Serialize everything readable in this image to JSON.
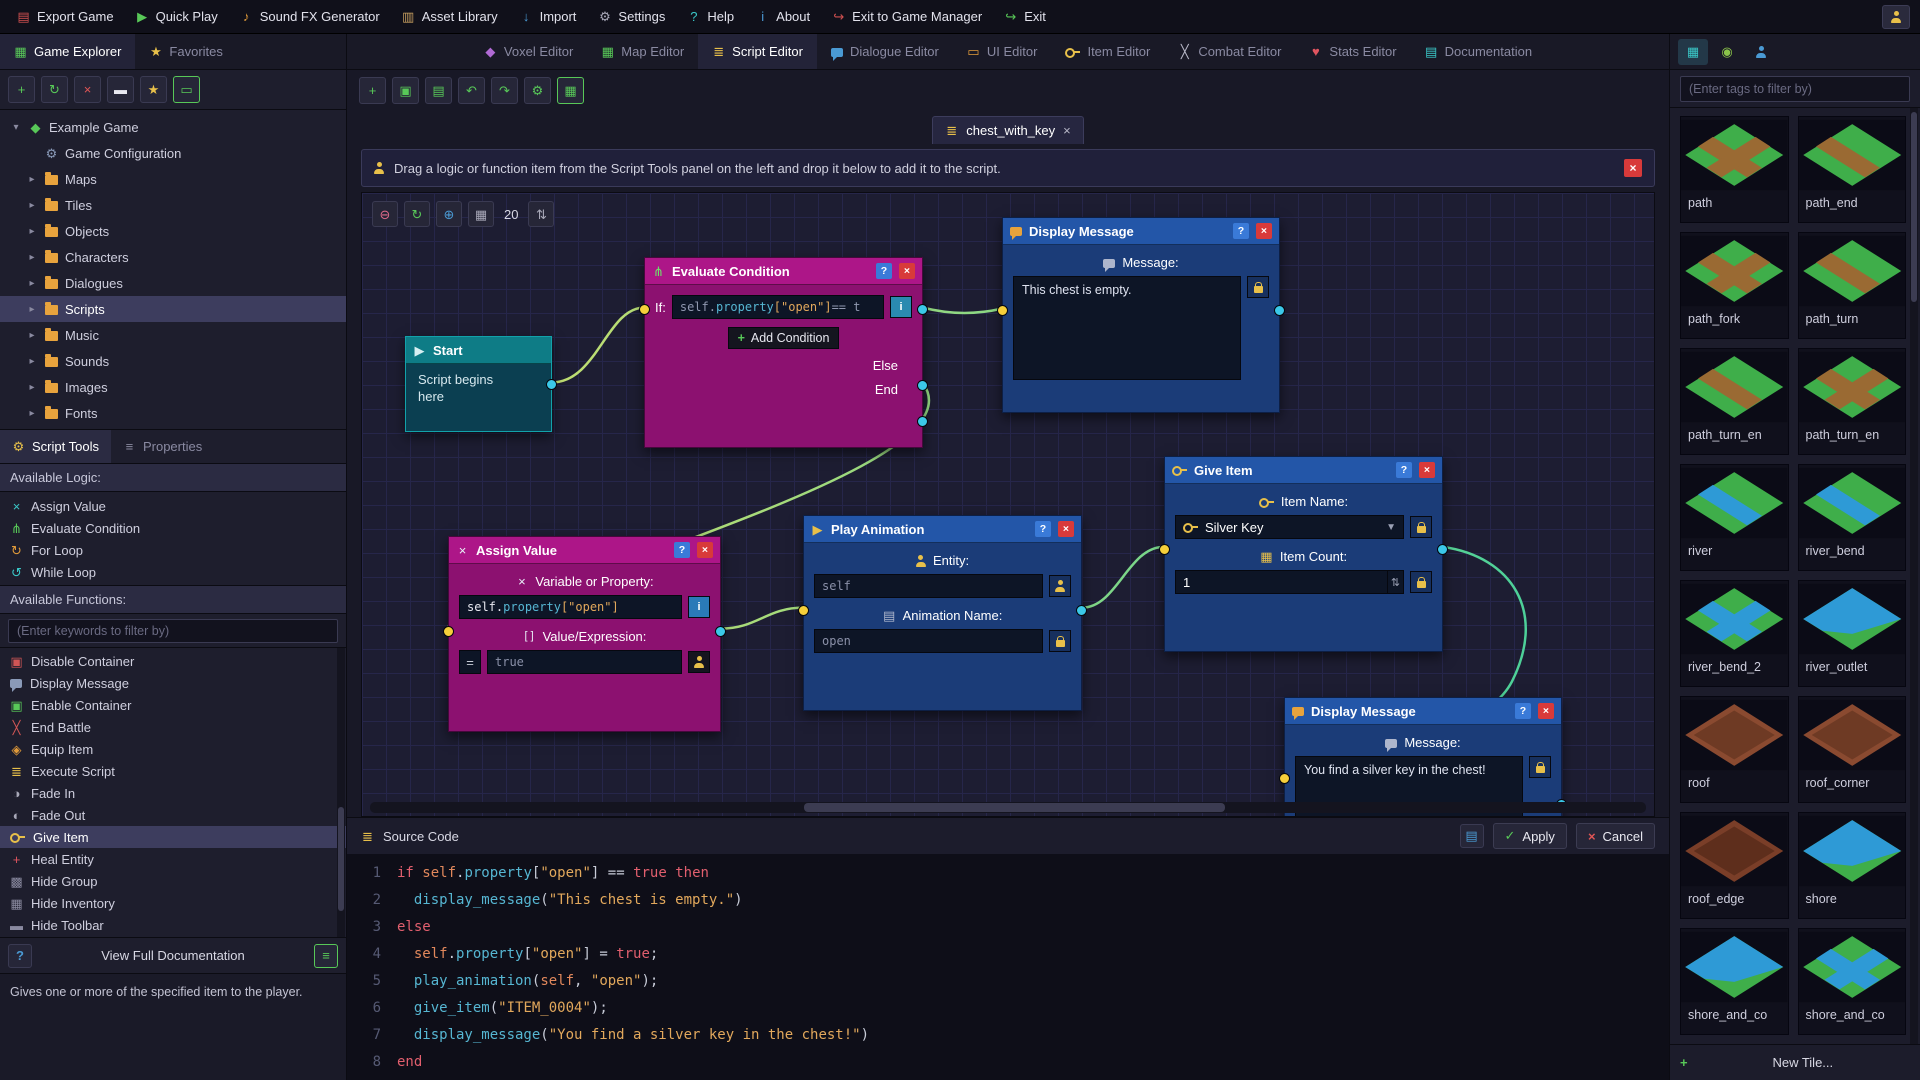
{
  "menubar": {
    "items": [
      {
        "label": "Export Game",
        "icon": "export"
      },
      {
        "label": "Quick Play",
        "icon": "play"
      },
      {
        "label": "Sound FX Generator",
        "icon": "sound"
      },
      {
        "label": "Asset Library",
        "icon": "library"
      },
      {
        "label": "Import",
        "icon": "import"
      },
      {
        "label": "Settings",
        "icon": "settings"
      },
      {
        "label": "Help",
        "icon": "help"
      },
      {
        "label": "About",
        "icon": "about"
      },
      {
        "label": "Exit to Game Manager",
        "icon": "exit-manager"
      },
      {
        "label": "Exit",
        "icon": "exit"
      }
    ]
  },
  "tab_row": {
    "left_tabs": [
      {
        "label": "Game Explorer",
        "icon": "grid",
        "active": true
      },
      {
        "label": "Favorites",
        "icon": "star",
        "active": false
      }
    ],
    "editor_tabs": [
      {
        "label": "Voxel Editor",
        "icon": "voxel",
        "active": false
      },
      {
        "label": "Map Editor",
        "icon": "map",
        "active": false
      },
      {
        "label": "Script Editor",
        "icon": "script",
        "active": true
      },
      {
        "label": "Dialogue Editor",
        "icon": "dialogue",
        "active": false
      },
      {
        "label": "UI Editor",
        "icon": "ui",
        "active": false
      },
      {
        "label": "Item Editor",
        "icon": "item",
        "active": false
      },
      {
        "label": "Combat Editor",
        "icon": "combat",
        "active": false
      },
      {
        "label": "Stats Editor",
        "icon": "stats",
        "active": false
      },
      {
        "label": "Documentation",
        "icon": "docs",
        "active": false
      }
    ],
    "right_tabs": [
      {
        "icon": "tiles",
        "active": true
      },
      {
        "icon": "bulb",
        "active": false
      },
      {
        "icon": "userblue",
        "active": false
      }
    ]
  },
  "explorer": {
    "toolbar": [
      {
        "icon": "add"
      },
      {
        "icon": "refresh"
      },
      {
        "icon": "delete"
      },
      {
        "icon": "collapse"
      },
      {
        "icon": "favorite"
      },
      {
        "icon": "panel-toggle",
        "framed": true
      }
    ],
    "tree": [
      {
        "label": "Example Game",
        "icon": "game",
        "level": 0,
        "expanded": true,
        "selected": false,
        "leaf": false
      },
      {
        "label": "Game Configuration",
        "icon": "config",
        "level": 1,
        "expanded": false,
        "selected": false,
        "leaf": true
      },
      {
        "label": "Maps",
        "icon": "folder",
        "level": 1,
        "expanded": false,
        "selected": false,
        "leaf": false
      },
      {
        "label": "Tiles",
        "icon": "folder",
        "level": 1,
        "expanded": false,
        "selected": false,
        "leaf": false
      },
      {
        "label": "Objects",
        "icon": "folder",
        "level": 1,
        "expanded": false,
        "selected": false,
        "leaf": false
      },
      {
        "label": "Characters",
        "icon": "folder",
        "level": 1,
        "expanded": false,
        "selected": false,
        "leaf": false
      },
      {
        "label": "Dialogues",
        "icon": "folder",
        "level": 1,
        "expanded": false,
        "selected": false,
        "leaf": false
      },
      {
        "label": "Scripts",
        "icon": "folder",
        "level": 1,
        "expanded": false,
        "selected": true,
        "leaf": false
      },
      {
        "label": "Music",
        "icon": "folder",
        "level": 1,
        "expanded": false,
        "selected": false,
        "leaf": false
      },
      {
        "label": "Sounds",
        "icon": "folder",
        "level": 1,
        "expanded": false,
        "selected": false,
        "leaf": false
      },
      {
        "label": "Images",
        "icon": "folder",
        "level": 1,
        "expanded": false,
        "selected": false,
        "leaf": false
      },
      {
        "label": "Fonts",
        "icon": "folder",
        "level": 1,
        "expanded": false,
        "selected": false,
        "leaf": false
      }
    ]
  },
  "script_tools": {
    "tabs": [
      {
        "label": "Script Tools",
        "icon": "tools",
        "active": true
      },
      {
        "label": "Properties",
        "icon": "props",
        "active": false
      }
    ],
    "logic_header": "Available Logic:",
    "logic": [
      {
        "label": "Assign Value",
        "icon": "assign"
      },
      {
        "label": "Evaluate Condition",
        "icon": "evaluate"
      },
      {
        "label": "For Loop",
        "icon": "for"
      },
      {
        "label": "While Loop",
        "icon": "while"
      }
    ],
    "functions_header": "Available Functions:",
    "filter_placeholder": "(Enter keywords to filter by)",
    "functions": [
      {
        "label": "Disable Container",
        "icon": "disable-container",
        "selected": false
      },
      {
        "label": "Display Message",
        "icon": "display-message",
        "selected": false
      },
      {
        "label": "Enable Container",
        "icon": "enable-container",
        "selected": false
      },
      {
        "label": "End Battle",
        "icon": "end-battle",
        "selected": false
      },
      {
        "label": "Equip Item",
        "icon": "equip-item",
        "selected": false
      },
      {
        "label": "Execute Script",
        "icon": "execute-script",
        "selected": false
      },
      {
        "label": "Fade In",
        "icon": "fade-in",
        "selected": false
      },
      {
        "label": "Fade Out",
        "icon": "fade-out",
        "selected": false
      },
      {
        "label": "Give Item",
        "icon": "key",
        "selected": true
      },
      {
        "label": "Heal Entity",
        "icon": "heal",
        "selected": false
      },
      {
        "label": "Hide Group",
        "icon": "hide-group",
        "selected": false
      },
      {
        "label": "Hide Inventory",
        "icon": "hide-inventory",
        "selected": false
      },
      {
        "label": "Hide Toolbar",
        "icon": "hide-toolbar",
        "selected": false
      }
    ],
    "doc_button": "View Full Documentation",
    "description": "Gives one or more of the specified item to the player."
  },
  "editor": {
    "toolbar": [
      {
        "icon": "new"
      },
      {
        "icon": "save"
      },
      {
        "icon": "copy"
      },
      {
        "icon": "undo"
      },
      {
        "icon": "redo"
      },
      {
        "icon": "settings2"
      },
      {
        "icon": "grid-toggle",
        "framed": true
      }
    ],
    "script_tab": {
      "label": "chest_with_key"
    },
    "hint": "Drag a logic or function item from the Script Tools panel on the left and drop it below to add it to the script.",
    "canvas_toolbar": {
      "grid_size": "20"
    }
  },
  "nodes": {
    "start": {
      "title": "Start",
      "body_line1": "Script begins",
      "body_line2": "here"
    },
    "evaluate": {
      "title": "Evaluate Condition",
      "if_label": "If:",
      "condition_segments": [
        {
          "t": "self",
          "c": "dim"
        },
        {
          "t": ".",
          "c": "dim"
        },
        {
          "t": "property",
          "c": "p"
        },
        {
          "t": "[\"open\"]",
          "c": "s"
        },
        {
          "t": " == t",
          "c": "dim"
        }
      ],
      "add_condition_label": "Add Condition",
      "else_label": "Else",
      "end_label": "End"
    },
    "display1": {
      "title": "Display Message",
      "message_label": "Message:",
      "message": "This chest is empty."
    },
    "assign": {
      "title": "Assign Value",
      "var_label": "Variable or Property:",
      "var_segments": [
        {
          "t": "self",
          "c": "w"
        },
        {
          "t": ".",
          "c": "w"
        },
        {
          "t": "property",
          "c": "p"
        },
        {
          "t": "[\"open\"]",
          "c": "s"
        }
      ],
      "value_label": "Value/Expression:",
      "value_bracket_icon": "[ ]",
      "equals": "=",
      "value": "true"
    },
    "play": {
      "title": "Play Animation",
      "entity_label": "Entity:",
      "entity_value": "self",
      "anim_label": "Animation Name:",
      "anim_value": "open"
    },
    "give": {
      "title": "Give Item",
      "item_label": "Item Name:",
      "item_value": "Silver Key",
      "count_label": "Item Count:",
      "count_value": "1"
    },
    "display2": {
      "title": "Display Message",
      "message_label": "Message:",
      "message": "You find a silver key in the chest!"
    }
  },
  "source": {
    "title": "Source Code",
    "apply_label": "Apply",
    "cancel_label": "Cancel",
    "lines": [
      [
        {
          "t": "if ",
          "c": "k"
        },
        {
          "t": "self",
          "c": "b"
        },
        {
          "t": ".",
          "c": "o"
        },
        {
          "t": "property",
          "c": "p"
        },
        {
          "t": "[",
          "c": "o"
        },
        {
          "t": "\"open\"",
          "c": "s"
        },
        {
          "t": "]",
          "c": "o"
        },
        {
          "t": " == ",
          "c": "o"
        },
        {
          "t": "true",
          "c": "k"
        },
        {
          "t": " then",
          "c": "k"
        }
      ],
      [
        {
          "t": "  ",
          "c": "o"
        },
        {
          "t": "display_message",
          "c": "f"
        },
        {
          "t": "(",
          "c": "o"
        },
        {
          "t": "\"This chest is empty.\"",
          "c": "s"
        },
        {
          "t": ")",
          "c": "o"
        }
      ],
      [
        {
          "t": "else",
          "c": "k"
        }
      ],
      [
        {
          "t": "  ",
          "c": "o"
        },
        {
          "t": "self",
          "c": "b"
        },
        {
          "t": ".",
          "c": "o"
        },
        {
          "t": "property",
          "c": "p"
        },
        {
          "t": "[",
          "c": "o"
        },
        {
          "t": "\"open\"",
          "c": "s"
        },
        {
          "t": "]",
          "c": "o"
        },
        {
          "t": " = ",
          "c": "o"
        },
        {
          "t": "true",
          "c": "k"
        },
        {
          "t": ";",
          "c": "o"
        }
      ],
      [
        {
          "t": "  ",
          "c": "o"
        },
        {
          "t": "play_animation",
          "c": "f"
        },
        {
          "t": "(",
          "c": "o"
        },
        {
          "t": "self",
          "c": "b"
        },
        {
          "t": ", ",
          "c": "o"
        },
        {
          "t": "\"open\"",
          "c": "s"
        },
        {
          "t": ")",
          "c": "o"
        },
        {
          "t": ";",
          "c": "o"
        }
      ],
      [
        {
          "t": "  ",
          "c": "o"
        },
        {
          "t": "give_item",
          "c": "f"
        },
        {
          "t": "(",
          "c": "o"
        },
        {
          "t": "\"ITEM_0004\"",
          "c": "s"
        },
        {
          "t": ")",
          "c": "o"
        },
        {
          "t": ";",
          "c": "o"
        }
      ],
      [
        {
          "t": "  ",
          "c": "o"
        },
        {
          "t": "display_message",
          "c": "f"
        },
        {
          "t": "(",
          "c": "o"
        },
        {
          "t": "\"You find a silver key in the chest!\"",
          "c": "s"
        },
        {
          "t": ")",
          "c": "o"
        }
      ],
      [
        {
          "t": "end",
          "c": "k"
        }
      ]
    ]
  },
  "right_panel": {
    "filter_placeholder": "(Enter tags to filter by)",
    "tiles": [
      {
        "name": "path",
        "base": "#3fae4a",
        "accent": "#9a6a33",
        "shape": "cross"
      },
      {
        "name": "path_end",
        "base": "#3fae4a",
        "accent": "#9a6a33",
        "shape": "stripe"
      },
      {
        "name": "path_fork",
        "base": "#3fae4a",
        "accent": "#9a6a33",
        "shape": "cross"
      },
      {
        "name": "path_turn",
        "base": "#3fae4a",
        "accent": "#9a6a33",
        "shape": "stripe"
      },
      {
        "name": "path_turn_en",
        "base": "#3fae4a",
        "accent": "#9a6a33",
        "shape": "stripe"
      },
      {
        "name": "path_turn_en",
        "base": "#3fae4a",
        "accent": "#9a6a33",
        "shape": "cross"
      },
      {
        "name": "river",
        "base": "#3fae4a",
        "accent": "#2e9ad6",
        "shape": "stripe"
      },
      {
        "name": "river_bend",
        "base": "#3fae4a",
        "accent": "#2e9ad6",
        "shape": "stripe"
      },
      {
        "name": "river_bend_2",
        "base": "#3fae4a",
        "accent": "#2e9ad6",
        "shape": "cross"
      },
      {
        "name": "river_outlet",
        "base": "#3fae4a",
        "accent": "#2e9ad6",
        "shape": "half"
      },
      {
        "name": "roof",
        "base": "#8a4a30",
        "accent": "#6e3a24",
        "shape": "full"
      },
      {
        "name": "roof_corner",
        "base": "#8a4a30",
        "accent": "#6e3a24",
        "shape": "full"
      },
      {
        "name": "roof_edge",
        "base": "#7a3e28",
        "accent": "#5e2e1c",
        "shape": "full"
      },
      {
        "name": "shore",
        "base": "#3fae4a",
        "accent": "#2e9ad6",
        "shape": "half"
      },
      {
        "name": "shore_and_co",
        "base": "#3fae4a",
        "accent": "#2e9ad6",
        "shape": "half"
      },
      {
        "name": "shore_and_co",
        "base": "#3fae4a",
        "accent": "#2e9ad6",
        "shape": "cross"
      }
    ],
    "new_tile_label": "New Tile..."
  },
  "colors": {
    "port_in": "#f5cf3a",
    "port_out": "#3bc8e8",
    "wire_start": "#d6e06a",
    "wire_end": "#3ecf9e",
    "node_blue": "#1b3c78",
    "node_magenta": "#8c1170",
    "node_teal": "#0b3f51"
  }
}
